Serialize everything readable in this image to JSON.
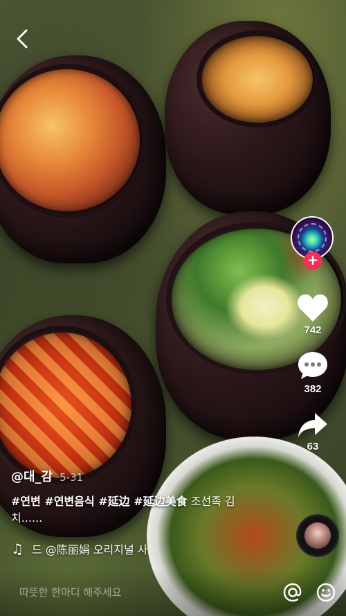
{
  "header": {
    "back_icon": "chevron-left-icon"
  },
  "video": {
    "description": "",
    "author": "@대_감",
    "date": "5-31",
    "caption_tags": "#연변 #연변음식 #延边 #延边美食",
    "caption_text": " 조선족 김치......",
    "music_text": "드   @陈丽娟 오리지널 사"
  },
  "actions": {
    "like_count": "742",
    "comment_count": "382",
    "share_count": "63",
    "accent_color": "#fe2c55"
  },
  "comment": {
    "placeholder": "따뜻한 한마디 해주세요"
  }
}
